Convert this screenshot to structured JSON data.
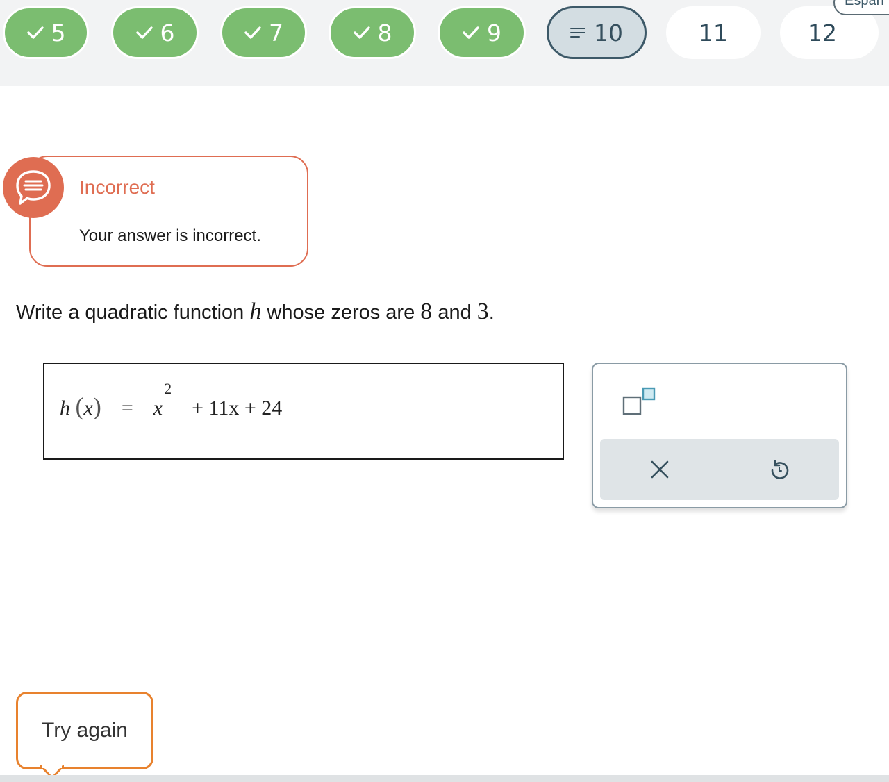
{
  "nav": {
    "questions": [
      {
        "label": "5",
        "status": "correct"
      },
      {
        "label": "6",
        "status": "correct"
      },
      {
        "label": "7",
        "status": "correct"
      },
      {
        "label": "8",
        "status": "correct"
      },
      {
        "label": "9",
        "status": "correct"
      },
      {
        "label": "10",
        "status": "current"
      },
      {
        "label": "11",
        "status": "unanswered"
      },
      {
        "label": "12",
        "status": "unanswered"
      }
    ],
    "language_button": "Españ"
  },
  "feedback": {
    "icon": "speech-bubble-lines-icon",
    "title": "Incorrect",
    "message": "Your answer is incorrect."
  },
  "question": {
    "part1": "Write a quadratic function ",
    "var": "h",
    "part2": " whose zeros are ",
    "zero1": "8",
    "part3": " and ",
    "zero2": "3",
    "part4": "."
  },
  "answer": {
    "fn": "h",
    "arg": "x",
    "eq": "=",
    "base": "x",
    "exponent": "2",
    "rest": "+ 11x + 24"
  },
  "palette": {
    "exponent_icon": "exponent-template-icon",
    "clear_icon": "close-icon",
    "undo_icon": "undo-icon"
  },
  "try_again": "Try again",
  "colors": {
    "correct": "#7bbd70",
    "incorrect": "#df6d52",
    "try_again_border": "#e8822e",
    "nav_text": "#2e4a5a"
  }
}
